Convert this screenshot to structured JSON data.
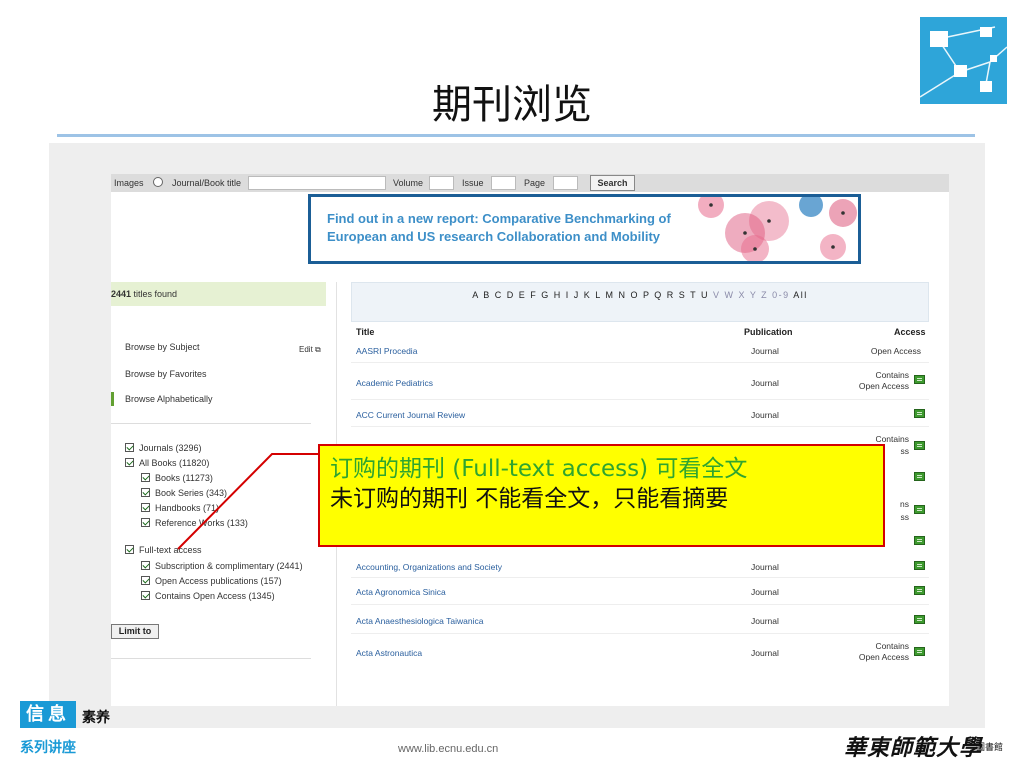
{
  "slide": {
    "title": "期刊浏览"
  },
  "search": {
    "images_label": "Images",
    "journal_label": "Journal/Book title",
    "volume_label": "Volume",
    "issue_label": "Issue",
    "page_label": "Page",
    "search_button": "Search"
  },
  "banner": {
    "line1": "Find out in a new report: Comparative Benchmarking of",
    "line2": "European and US research Collaboration and Mobility"
  },
  "results": {
    "count": "2441",
    "suffix": " titles found"
  },
  "alphabet": {
    "dark": "A B C D E F G H I J K L M N O P Q R S T U",
    "light": " V W X Y Z 0-9 ",
    "all": "All"
  },
  "sidebar": {
    "browse_subject": "Browse by Subject",
    "edit": "Edit",
    "browse_favorites": "Browse by Favorites",
    "browse_alpha": "Browse Alphabetically",
    "filters": [
      "Journals (3296)",
      "All Books  (11820)",
      "Books (11273)",
      "Book Series (343)",
      "Handbooks (71)",
      "Reference Works (133)",
      "Full-text access",
      "Subscription & complimentary (2441)",
      "Open Access publications (157)",
      "Contains Open Access (1345)"
    ],
    "limit_button": "Limit to"
  },
  "table": {
    "headers": {
      "title": "Title",
      "publication": "Publication",
      "access": "Access"
    },
    "rows": [
      {
        "title": "AASRI Procedia",
        "publication": "Journal",
        "access": "Open Access"
      },
      {
        "title": "Academic Pediatrics",
        "publication": "Journal",
        "access": "Contains\nOpen Access"
      },
      {
        "title": "ACC Current Journal Review",
        "publication": "Journal",
        "access": ""
      },
      {
        "title": "Accounting, Organizations and Society",
        "publication": "Journal",
        "access": ""
      },
      {
        "title": "Acta Agronomica Sinica",
        "publication": "Journal",
        "access": ""
      },
      {
        "title": "Acta Anaesthesiologica Taiwanica",
        "publication": "Journal",
        "access": ""
      },
      {
        "title": "Acta Astronautica",
        "publication": "Journal",
        "access": "Contains\nOpen Access"
      }
    ],
    "partial_access": [
      "Contains",
      "ss",
      "ns",
      "ss"
    ]
  },
  "callout": {
    "line1": "订购的期刊 (Full-text access) 可看全文",
    "line2": "未订购的期刊 不能看全文，只能看摘要"
  },
  "footer": {
    "badge": "信息",
    "badge_side": "素养",
    "series": "系列讲座",
    "url": "www.lib.ecnu.edu.cn",
    "university": "華東師範大學",
    "library": "圖書館"
  },
  "colors": {
    "accent_blue": "#1a9ad6",
    "callout_bg": "#ffff00",
    "callout_border": "#d40000",
    "callout_green": "#2fa52f",
    "title_rule": "#9dc3e6",
    "access_green": "#3d9a2e"
  }
}
